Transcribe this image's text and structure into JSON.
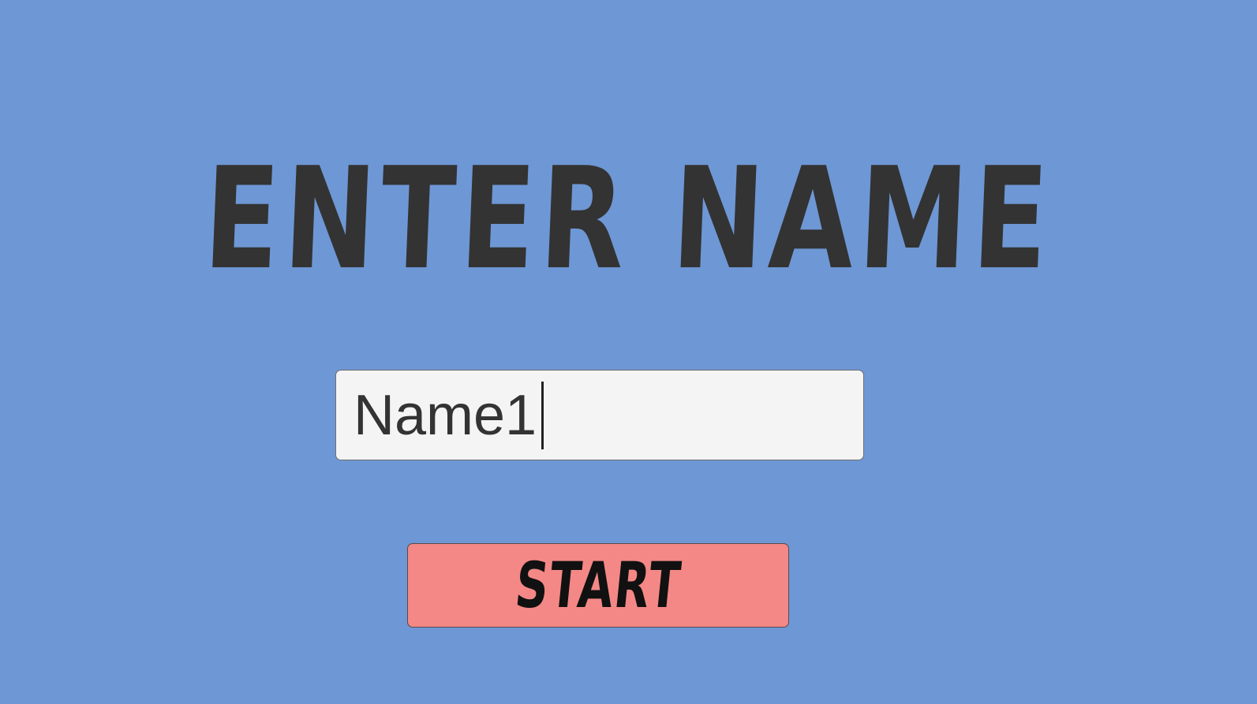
{
  "screen": {
    "background_color": "#6e97d5"
  },
  "title": {
    "text": "ENTER NAME",
    "color": "#333333"
  },
  "name_input": {
    "value": "Name1",
    "field_color": "#f4f4f4",
    "focused": true
  },
  "start_button": {
    "label": "START",
    "color": "#f48886"
  }
}
